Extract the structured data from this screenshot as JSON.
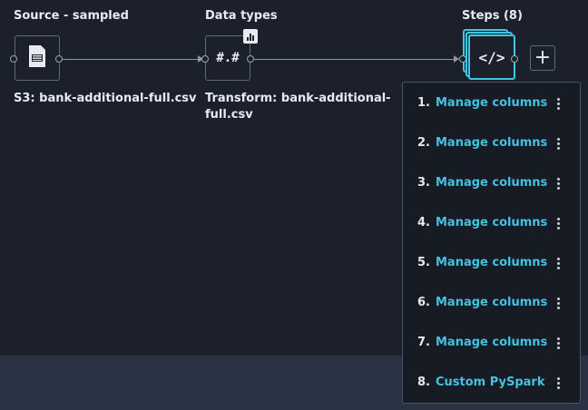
{
  "source": {
    "title": "Source - sampled",
    "label": "S3: bank-additional-full.csv",
    "icon": "csv-file-icon"
  },
  "data_types": {
    "title": "Data types",
    "glyph": "#.#",
    "label_line1": "Transform: bank-additional-",
    "label_line2": "full.csv",
    "badge_icon": "bar-chart-icon"
  },
  "steps": {
    "title": "Steps (8)",
    "glyph": "</>",
    "add_glyph": "+",
    "items": [
      {
        "num": "1.",
        "label": "Manage columns"
      },
      {
        "num": "2.",
        "label": "Manage columns"
      },
      {
        "num": "3.",
        "label": "Manage columns"
      },
      {
        "num": "4.",
        "label": "Manage columns"
      },
      {
        "num": "5.",
        "label": "Manage columns"
      },
      {
        "num": "6.",
        "label": "Manage columns"
      },
      {
        "num": "7.",
        "label": "Manage columns"
      },
      {
        "num": "8.",
        "label": "Custom PySpark"
      }
    ]
  },
  "colors": {
    "background": "#1b202b",
    "footer": "#2a3343",
    "accent": "#44c2df",
    "text": "#e7ebf0"
  }
}
